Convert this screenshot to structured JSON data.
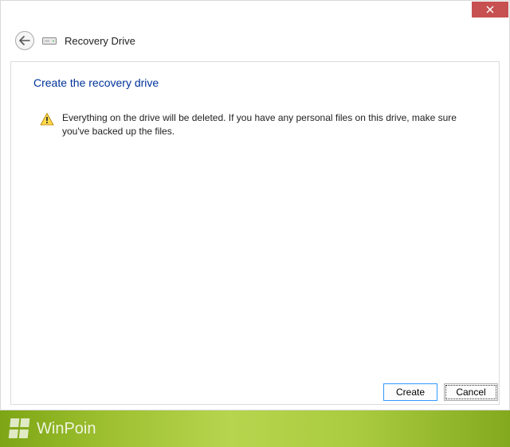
{
  "window": {
    "title": "Recovery Drive"
  },
  "content": {
    "heading": "Create the recovery drive",
    "warning_text": "Everything on the drive will be deleted. If you have any personal files on this drive, make sure you've backed up the files."
  },
  "buttons": {
    "create": "Create",
    "cancel": "Cancel"
  },
  "watermark": {
    "text": "WinPoin"
  }
}
